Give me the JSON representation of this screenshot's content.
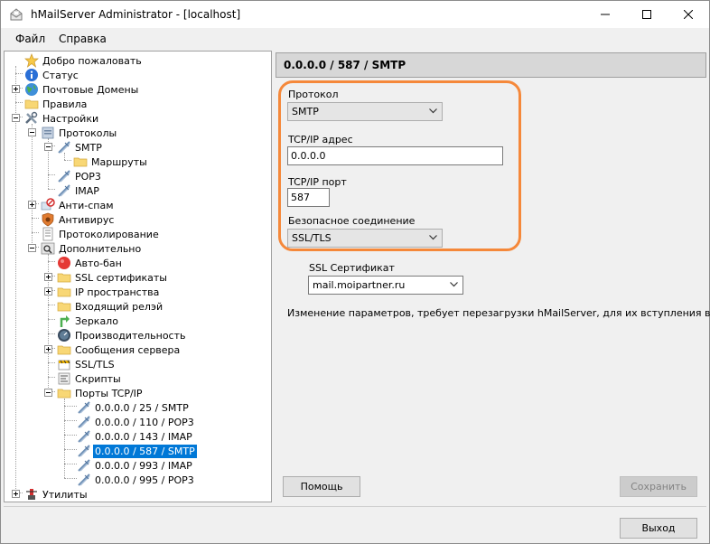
{
  "window": {
    "title": "hMailServer Administrator - [localhost]",
    "controls": {
      "minimize": "minimize",
      "maximize": "maximize",
      "close": "close"
    }
  },
  "menu": {
    "file": "Файл",
    "help": "Справка"
  },
  "tree": {
    "items": [
      {
        "label": "Добро пожаловать",
        "icon": "star-icon"
      },
      {
        "label": "Статус",
        "icon": "info-icon"
      },
      {
        "label": "Почтовые Домены",
        "icon": "globe-icon"
      },
      {
        "label": "Правила",
        "icon": "folder-icon"
      },
      {
        "label": "Настройки",
        "icon": "tools-icon"
      },
      {
        "label": "Протоколы",
        "icon": "protocols-icon"
      },
      {
        "label": "SMTP",
        "icon": "plug-icon"
      },
      {
        "label": "Маршруты",
        "icon": "folder-icon"
      },
      {
        "label": "POP3",
        "icon": "plug-icon"
      },
      {
        "label": "IMAP",
        "icon": "plug-icon"
      },
      {
        "label": "Анти-спам",
        "icon": "antispam-icon"
      },
      {
        "label": "Антивирус",
        "icon": "antivirus-icon"
      },
      {
        "label": "Протоколирование",
        "icon": "log-icon"
      },
      {
        "label": "Дополнительно",
        "icon": "advanced-icon"
      },
      {
        "label": "Авто-бан",
        "icon": "autoban-icon"
      },
      {
        "label": "SSL сертификаты",
        "icon": "folder-icon"
      },
      {
        "label": "IP пространства",
        "icon": "folder-icon"
      },
      {
        "label": "Входящий релэй",
        "icon": "folder-icon"
      },
      {
        "label": "Зеркало",
        "icon": "mirror-icon"
      },
      {
        "label": "Производительность",
        "icon": "performance-icon"
      },
      {
        "label": "Сообщения сервера",
        "icon": "folder-icon"
      },
      {
        "label": "SSL/TLS",
        "icon": "ssl-icon"
      },
      {
        "label": "Скрипты",
        "icon": "scripts-icon"
      },
      {
        "label": "Порты TCP/IP",
        "icon": "folder-icon"
      },
      {
        "label": "0.0.0.0 / 25 / SMTP",
        "icon": "plug-icon"
      },
      {
        "label": "0.0.0.0 / 110 / POP3",
        "icon": "plug-icon"
      },
      {
        "label": "0.0.0.0 / 143 / IMAP",
        "icon": "plug-icon"
      },
      {
        "label": "0.0.0.0 / 587 / SMTP",
        "icon": "plug-icon",
        "selected": true
      },
      {
        "label": "0.0.0.0 / 993 / IMAP",
        "icon": "plug-icon"
      },
      {
        "label": "0.0.0.0 / 995 / POP3",
        "icon": "plug-icon"
      },
      {
        "label": "Утилиты",
        "icon": "utilities-icon"
      }
    ]
  },
  "panel": {
    "header": "0.0.0.0 / 587 / SMTP",
    "protocol_label": "Протокол",
    "protocol_value": "SMTP",
    "address_label": "TCP/IP адрес",
    "address_value": "0.0.0.0",
    "port_label": "TCP/IP порт",
    "port_value": "587",
    "secure_label": "Безопасное соединение",
    "secure_value": "SSL/TLS",
    "cert_label": "SSL Сертификат",
    "cert_value": "mail.moipartner.ru",
    "info": "Изменение параметров, требует перезагрузки hMailServer, для их вступления в силу.",
    "help_button": "Помощь",
    "save_button": "Сохранить",
    "exit_button": "Выход"
  },
  "colors": {
    "accent": "#0078d7",
    "highlight_ring": "#f5883a"
  }
}
